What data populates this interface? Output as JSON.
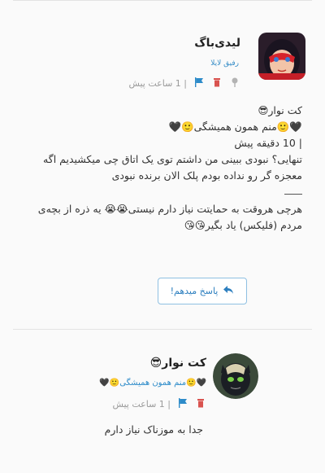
{
  "post1": {
    "author_name": "لیدی‌باگ",
    "author_role": "رفیق لایلا",
    "time": "| 1 ساعت پیش",
    "lines": [
      "کت نوار😎",
      "🖤🙂منم همون همیشگی🙂🖤",
      "| 10 دقیقه پیش",
      "تنهایی؟ نبودی ببینی من داشتم توی یک اتاق چی میکشیدیم اگه معجزه گر رو نداده بودم پلک الان برنده نبودی",
      "هرچی هروقت به حمایتت نیاز دارم نیستی😭😭 یه ذره از بچه‌ی مردم (فلیکس) یاد بگیر😘😘"
    ],
    "reply_label": "پاسخ میدهم!"
  },
  "post2": {
    "author_name": "کت نوار😎",
    "author_subtitle": "🖤🙂منم همون همیشگی🙂🖤",
    "time": "| 1 ساعت پیش",
    "text": "جدا به موزناک نیاز دارم"
  },
  "icons": {
    "pin": "pin-icon",
    "trash": "trash-icon",
    "flag": "flag-icon",
    "reply": "reply-arrow-icon"
  },
  "colors": {
    "accent": "#2d8bc9",
    "danger": "#d9534f",
    "muted": "#9a9a9a"
  }
}
